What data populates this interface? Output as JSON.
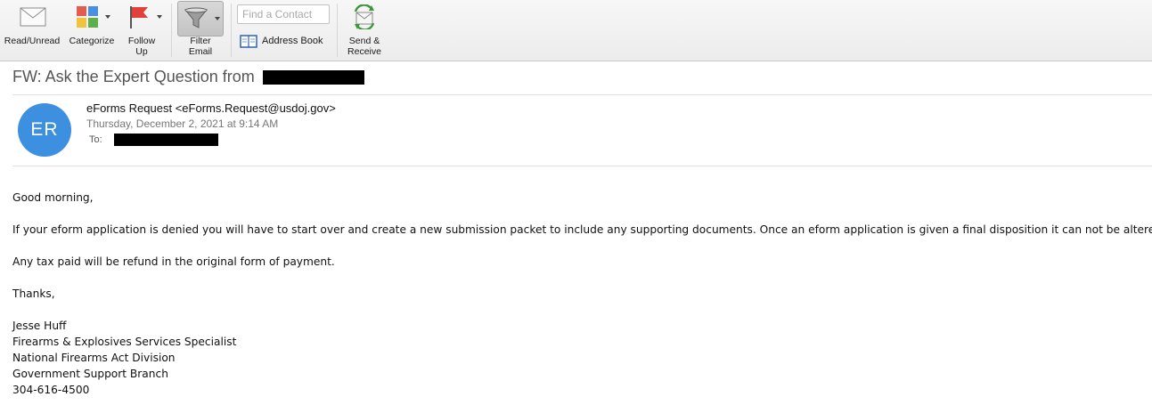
{
  "toolbar": {
    "read_unread": "Read/Unread",
    "categorize": "Categorize",
    "follow_up": "Follow\nUp",
    "filter_email": "Filter\nEmail",
    "find_contact_placeholder": "Find a Contact",
    "address_book": "Address Book",
    "send_receive": "Send &\nReceive"
  },
  "message": {
    "subject": "FW: Ask the Expert Question from",
    "avatar_initials": "ER",
    "avatar_color": "#3d8fe0",
    "sender": "eForms Request <eForms.Request@usdoj.gov>",
    "date": "Thursday, December 2, 2021 at 9:14 AM",
    "to_label": "To:"
  },
  "body": {
    "greeting": "Good morning,",
    "paragraph1": "If your eform application is denied you will have to start over and create a new submission packet to include any supporting documents. Once an eform application is given a final disposition it can not be altered.",
    "paragraph2": "Any tax paid will be refund in the original form of payment.",
    "closing": "Thanks,",
    "signature": [
      "Jesse Huff",
      "Firearms & Explosives Services Specialist",
      "National Firearms Act Division",
      "Government Support Branch",
      "304-616-4500"
    ]
  },
  "icons": {
    "read_unread": "envelope-icon",
    "categorize": "category-grid-icon",
    "follow_up": "flag-icon",
    "filter_email": "funnel-icon",
    "address_book": "address-book-icon",
    "send_receive": "send-receive-icon"
  }
}
